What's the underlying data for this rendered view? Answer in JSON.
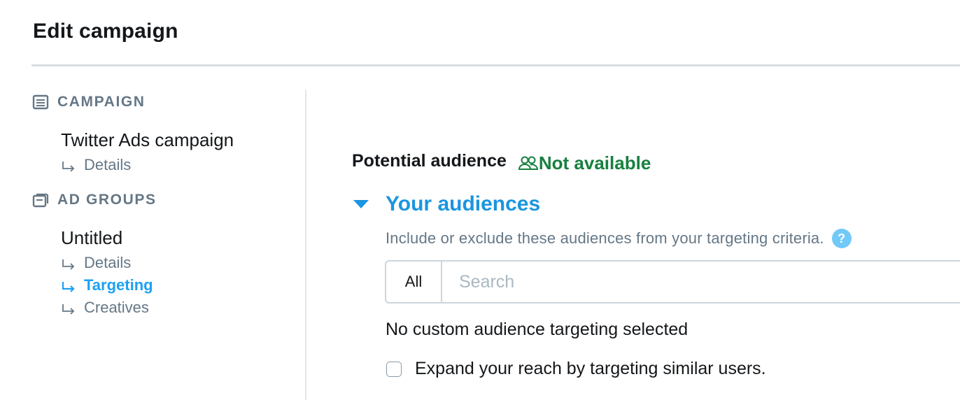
{
  "page": {
    "title": "Edit campaign"
  },
  "sidebar": {
    "campaign_section": {
      "label": "CAMPAIGN",
      "icon": "list-icon",
      "item_title": "Twitter Ads campaign",
      "links": [
        "Details"
      ]
    },
    "ad_groups_section": {
      "label": "AD GROUPS",
      "icon": "stack-icon",
      "item_title": "Untitled",
      "links": [
        {
          "label": "Details",
          "active": false
        },
        {
          "label": "Targeting",
          "active": true
        },
        {
          "label": "Creatives",
          "active": false
        }
      ]
    }
  },
  "main": {
    "potential_audience": {
      "label": "Potential audience",
      "status": "Not available",
      "status_icon": "people-icon"
    },
    "your_audiences": {
      "title": "Your audiences",
      "description": "Include or exclude these audiences from your targeting criteria.",
      "help_label": "?",
      "filter_label": "All",
      "search_placeholder": "Search",
      "empty_message": "No custom audience targeting selected",
      "expand_label": "Expand your reach by targeting similar users."
    }
  },
  "colors": {
    "accent": "#1da1f2",
    "heading_blue": "#1b95e0",
    "success_green": "#17803f",
    "muted_gray": "#657786"
  }
}
